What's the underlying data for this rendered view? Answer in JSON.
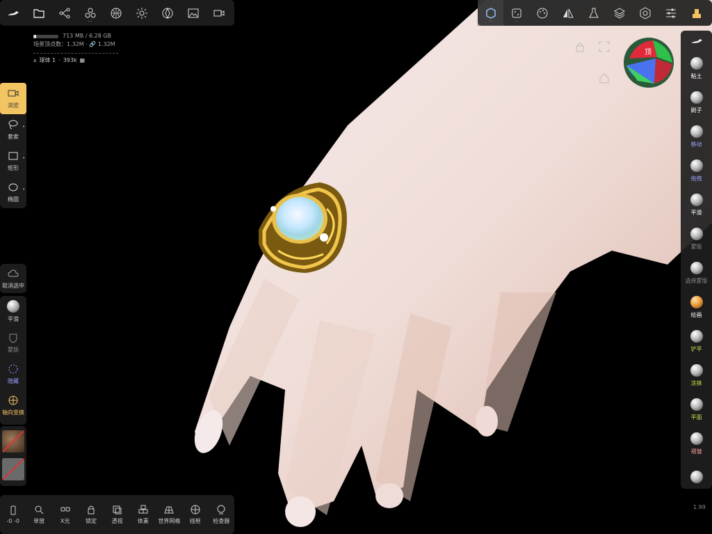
{
  "top_toolbar_left": [
    {
      "name": "logo-icon"
    },
    {
      "name": "folder-icon"
    },
    {
      "name": "scene-tree-icon"
    },
    {
      "name": "shapes-icon"
    },
    {
      "name": "grid-sphere-icon"
    },
    {
      "name": "light-icon"
    },
    {
      "name": "aperture-icon"
    },
    {
      "name": "image-icon"
    },
    {
      "name": "video-icon"
    }
  ],
  "top_toolbar_right": [
    {
      "name": "cube-select-icon"
    },
    {
      "name": "dice-icon"
    },
    {
      "name": "palette-icon"
    },
    {
      "name": "symmetry-icon"
    },
    {
      "name": "flask-icon"
    },
    {
      "name": "layers-icon"
    },
    {
      "name": "settings-icon"
    },
    {
      "name": "sliders-icon"
    },
    {
      "name": "stamp-icon"
    }
  ],
  "stats": {
    "memory": "713 MB / 6.28 GB",
    "memory_fraction": 0.11,
    "vertices": "场景顶点数：1.32M · 🔗 1.32M",
    "mesh_name": "球体 1",
    "mesh_count": "393k"
  },
  "left_tools": [
    {
      "label": "浏览",
      "icon": "camera-icon"
    },
    {
      "label": "套索",
      "icon": "lasso-icon"
    },
    {
      "label": "矩形",
      "icon": "rectangle-icon"
    },
    {
      "label": "椭圆",
      "icon": "ellipse-icon"
    }
  ],
  "left_deselect": {
    "label": "取消选中",
    "icon": "cloud-icon"
  },
  "left_group2": [
    {
      "label": "平滑",
      "icon": "smooth-icon"
    },
    {
      "label": "蒙版",
      "icon": "mask-icon"
    },
    {
      "label": "隐藏",
      "icon": "hide-icon"
    },
    {
      "label": "轴向变换",
      "icon": "gizmo-icon"
    }
  ],
  "right_tools": [
    {
      "label": "粘土",
      "color": "#ffffff"
    },
    {
      "label": "刷子",
      "color": "#ffffff"
    },
    {
      "label": "移动",
      "color": "#9aa0ff"
    },
    {
      "label": "拖拽",
      "color": "#9aa0ff"
    },
    {
      "label": "平滑",
      "color": "#ffffff"
    },
    {
      "label": "蒙版",
      "color": "#888888"
    },
    {
      "label": "选择蒙版",
      "color": "#888888"
    },
    {
      "label": "绘画",
      "color": "#ffffff"
    },
    {
      "label": "铲平",
      "color": "#c8e04a"
    },
    {
      "label": "涂抹",
      "color": "#c8e04a"
    },
    {
      "label": "平面",
      "color": "#c8e04a"
    },
    {
      "label": "褶皱",
      "color": "#ff9d9d"
    },
    {
      "label": "",
      "color": "#ffffff"
    }
  ],
  "bottom_bar": [
    {
      "label": "-0 -0",
      "icon": "phone-icon"
    },
    {
      "label": "单放",
      "icon": "zoom-icon"
    },
    {
      "label": "X光",
      "icon": "xray-icon"
    },
    {
      "label": "锁定",
      "icon": "lock-icon"
    },
    {
      "label": "透视",
      "icon": "perspective-icon"
    },
    {
      "label": "体素",
      "icon": "voxel-icon"
    },
    {
      "label": "世界网格",
      "icon": "world-grid-icon"
    },
    {
      "label": "线框",
      "icon": "wireframe-icon"
    },
    {
      "label": "检查器",
      "icon": "inspector-icon"
    }
  ],
  "gizmo": {
    "top_label": "顶"
  },
  "version": "1.99"
}
